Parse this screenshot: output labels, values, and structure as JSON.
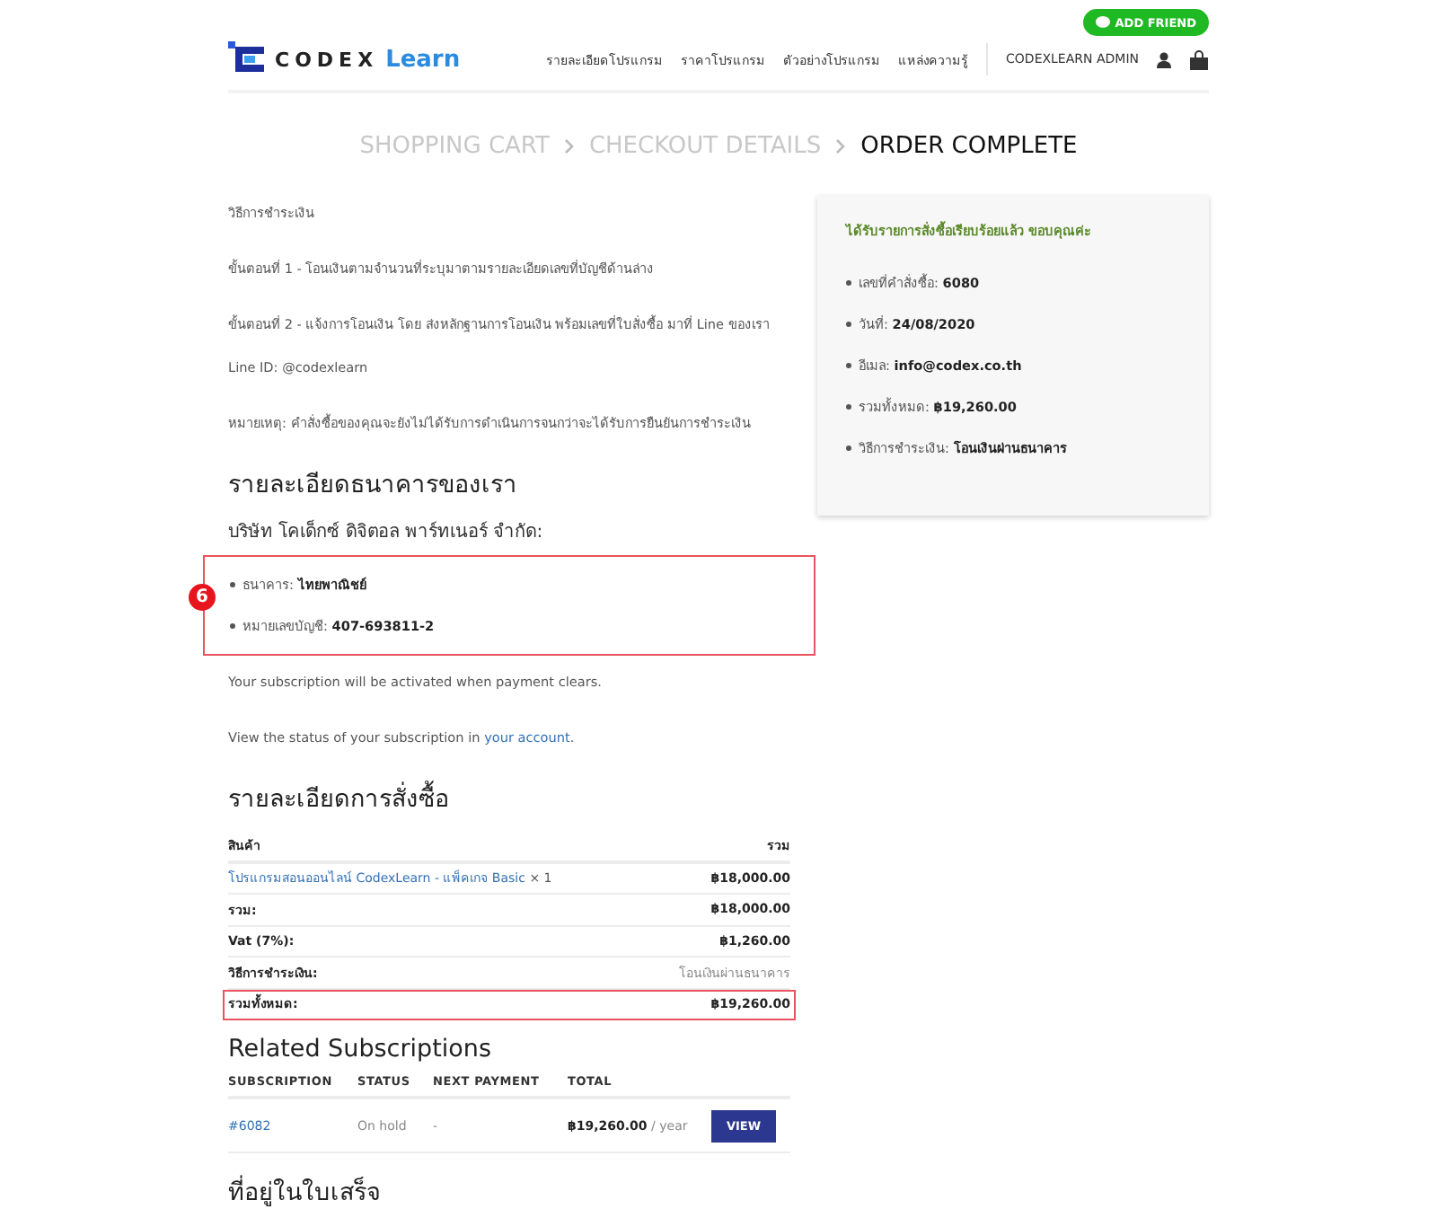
{
  "header": {
    "add_friend": "ADD FRIEND",
    "logo": {
      "brand": "CODEX",
      "accent": "Learn"
    },
    "nav": [
      {
        "label": "รายละเอียดโปรแกรม"
      },
      {
        "label": "ราคาโปรแกรม"
      },
      {
        "label": "ตัวอย่างโปรแกรม"
      },
      {
        "label": "แหล่งความรู้"
      }
    ],
    "account": "CODEXLEARN ADMIN"
  },
  "breadcrumb": [
    {
      "label": "SHOPPING CART",
      "selected": false
    },
    {
      "label": "CHECKOUT DETAILS",
      "selected": false
    },
    {
      "label": "ORDER COMPLETE",
      "selected": true
    }
  ],
  "instructions": [
    {
      "kind": "para",
      "text": "วิธีการชำระเงิน"
    },
    {
      "kind": "para",
      "text": "ขั้นตอนที่ 1 - โอนเงินตามจำนวนที่ระบุมาตามรายละเอียดเลขที่บัญชีด้านล่าง"
    },
    {
      "kind": "tight",
      "text": "ขั้นตอนที่ 2 - แจ้งการโอนเงิน โดย ส่งหลักฐานการโอนเงิน พร้อมเลขที่ใบสั่งซื้อ มาที่ Line ของเรา"
    },
    {
      "kind": "para",
      "text": "Line ID: @codexlearn"
    },
    {
      "kind": "para",
      "text": "หมายเหตุ: คำสั่งซื้อของคุณจะยังไม่ได้รับการดำเนินการจนกว่าจะได้รับการยืนยันการชำระเงิน"
    }
  ],
  "bank": {
    "heading": "รายละเอียดธนาคารของเรา",
    "company": "บริษัท โคเด็กซ์ ดิจิตอล พาร์ทเนอร์ จำกัด:",
    "highlighted": true,
    "badge": "6",
    "items": [
      {
        "label": "ธนาคาร:",
        "value": "ไทยพาณิชย์"
      },
      {
        "label": "หมายเลขบัญชี:",
        "value": "407-693811-2"
      }
    ]
  },
  "subscription_note": "Your subscription will be activated when payment clears.",
  "status_note": {
    "text": "View the status of your subscription in",
    "link": "your account",
    "end": "."
  },
  "order": {
    "heading": "รายละเอียดการสั่งซื้อ",
    "columns": [
      "สินค้า",
      "รวม"
    ],
    "item": {
      "name": "โปรแกรมสอนออนไลน์ CodexLearn - แพ็คเกจ Basic",
      "qty": "× 1",
      "total": "฿18,000.00"
    },
    "rows": [
      {
        "label": "รวม:",
        "value": "฿18,000.00",
        "kind": "amount",
        "highlighted": false
      },
      {
        "label": "Vat (7%):",
        "value": "฿1,260.00",
        "kind": "amount",
        "highlighted": false
      },
      {
        "label": "วิธีการชำระเงิน:",
        "value": "โอนเงินผ่านธนาคาร",
        "kind": "method",
        "highlighted": false
      },
      {
        "label": "รวมทั้งหมด:",
        "value": "฿19,260.00",
        "kind": "amount",
        "highlighted": true
      }
    ]
  },
  "related": {
    "heading": "Related Subscriptions",
    "columns": [
      "SUBSCRIPTION",
      "STATUS",
      "NEXT PAYMENT",
      "TOTAL"
    ],
    "rows": [
      {
        "id": "#6082",
        "status": "On hold",
        "next": "-",
        "total": "฿19,260.00",
        "period": "/ year",
        "action": "VIEW"
      }
    ]
  },
  "billing_heading": "ที่อยู่ในใบเสร็จ",
  "summary": {
    "title": "ได้รับรายการสั่งซื้อเรียบร้อยแล้ว ขอบคุณค่ะ",
    "items": [
      {
        "label": "เลขที่คำสั่งซื้อ:",
        "value": "6080"
      },
      {
        "label": "วันที่:",
        "value": "24/08/2020"
      },
      {
        "label": "อีเมล:",
        "value": "info@codex.co.th"
      },
      {
        "label": "รวมทั้งหมด:",
        "value": "฿19,260.00"
      },
      {
        "label": "วิธีการชำระเงิน:",
        "value": "โอนเงินผ่านธนาคาร"
      }
    ]
  }
}
